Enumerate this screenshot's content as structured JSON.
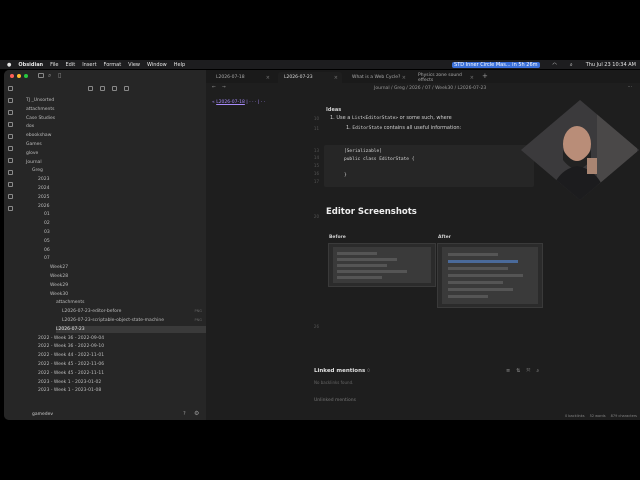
{
  "menubar": {
    "items": [
      "Obsidian",
      "File",
      "Edit",
      "Insert",
      "Format",
      "View",
      "Window",
      "Help"
    ],
    "event": "STD Inner Circle Mas... in 5h 26m",
    "datetime": "Thu Jul 23  10:34 AM"
  },
  "tabs": [
    {
      "label": "L2026-07-18"
    },
    {
      "label": "L2026-07-23",
      "active": true
    },
    {
      "label": "What is a Web Cycle?"
    },
    {
      "label": "Physics zone sound effects"
    }
  ],
  "header": {
    "breadcrumb": "Journal / Greg / 2026 / 07 / Week30 / L2026-07-23",
    "prev_link": "L2026-07-18"
  },
  "vault_name": "gamedev",
  "tree": [
    {
      "label": "TJ _Unsorted",
      "depth": 0
    },
    {
      "label": "attachments",
      "depth": 0
    },
    {
      "label": "Case Studies",
      "depth": 0
    },
    {
      "label": "dox",
      "depth": 0
    },
    {
      "label": "ebookshaw",
      "depth": 0
    },
    {
      "label": "Games",
      "depth": 0
    },
    {
      "label": "glove",
      "depth": 0
    },
    {
      "label": "Journal",
      "depth": 0
    },
    {
      "label": "Greg",
      "depth": 1
    },
    {
      "label": "2023",
      "depth": 2
    },
    {
      "label": "2024",
      "depth": 2
    },
    {
      "label": "2025",
      "depth": 2
    },
    {
      "label": "2026",
      "depth": 2
    },
    {
      "label": "01",
      "depth": 3
    },
    {
      "label": "02",
      "depth": 3
    },
    {
      "label": "03",
      "depth": 3
    },
    {
      "label": "05",
      "depth": 3
    },
    {
      "label": "06",
      "depth": 3
    },
    {
      "label": "07",
      "depth": 3
    },
    {
      "label": "Week27",
      "depth": 4
    },
    {
      "label": "Week28",
      "depth": 4
    },
    {
      "label": "Week29",
      "depth": 4
    },
    {
      "label": "Week30",
      "depth": 4
    },
    {
      "label": "attachments",
      "depth": 5
    },
    {
      "label": "L2026-07-23-editor-before",
      "depth": 6,
      "ext": "PNG"
    },
    {
      "label": "L2026-07-23-scriptable-object-state-machine",
      "depth": 6,
      "ext": "PNG"
    },
    {
      "label": "L2026-07-23",
      "depth": 5,
      "selected": true
    },
    {
      "label": "2022 - Week 36 - 2022-09-04",
      "depth": 2
    },
    {
      "label": "2022 - Week 36 - 2022-09-10",
      "depth": 2
    },
    {
      "label": "2022 - Week 44 - 2022-11-01",
      "depth": 2
    },
    {
      "label": "2022 - Week 45 - 2022-11-06",
      "depth": 2
    },
    {
      "label": "2022 - Week 45 - 2022-11-11",
      "depth": 2
    },
    {
      "label": "2023 - Week 1 - 2023-01-02",
      "depth": 2
    },
    {
      "label": "2023 - Week 1 - 2023-01-08",
      "depth": 2
    }
  ],
  "editor": {
    "heading_idea": "Ideas",
    "line1_pre": "Use a ",
    "line1_code": "List<EditorState>",
    "line1_post": " or some such, where",
    "line2_code": "EditorState",
    "line2_post": " contains all useful information:",
    "code_lines": [
      "[Serializable]",
      "public class EditorState {",
      "",
      "}"
    ],
    "screens_heading": "Editor Screenshots",
    "before_label": "Before",
    "after_label": "After",
    "linked_mentions": "Linked mentions",
    "linked_count": "0",
    "no_backlinks": "No backlinks found.",
    "unlinked": "Unlinked mentions"
  },
  "status": {
    "backlinks": "0 backlinks",
    "words": "52 words",
    "chars": "879 characters"
  }
}
